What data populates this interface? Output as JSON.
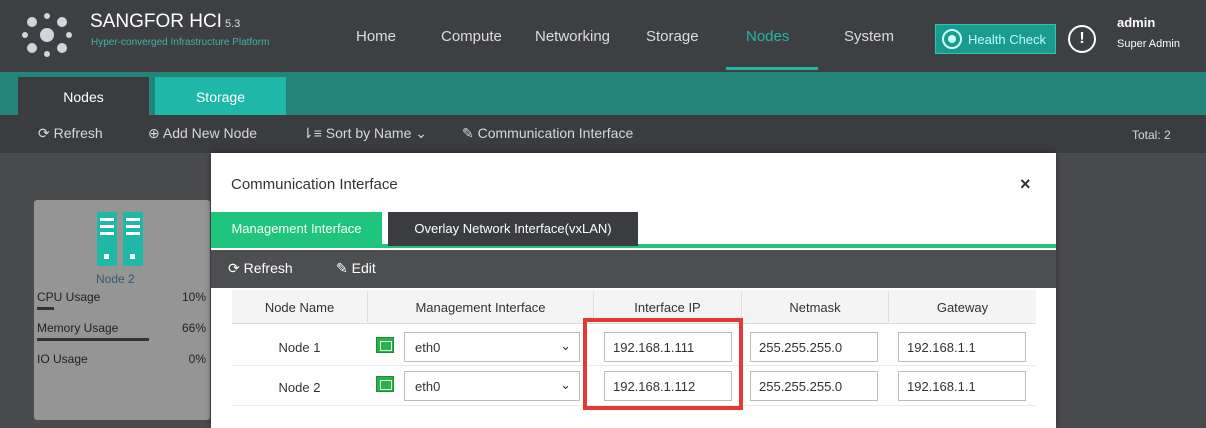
{
  "header": {
    "brand": "SANGFOR HCI",
    "version": "5.3",
    "subtitle": "Hyper-converged Infrastructure Platform",
    "nav": [
      "Home",
      "Compute",
      "Networking",
      "Storage",
      "Nodes",
      "System"
    ],
    "active_nav": "Nodes",
    "health_check": "Health Check",
    "user": "admin",
    "role": "Super Admin"
  },
  "subtabs": [
    "Nodes",
    "Storage"
  ],
  "toolbar": {
    "refresh": "Refresh",
    "add_node": "Add New Node",
    "sort": "Sort by Name",
    "comm_interface": "Communication Interface",
    "total": "Total: 2"
  },
  "node_card": {
    "name": "Node 2",
    "metrics": [
      {
        "label": "CPU Usage",
        "value": "10%",
        "level": 0.1
      },
      {
        "label": "Memory Usage",
        "value": "66%",
        "level": 0.66
      },
      {
        "label": "IO Usage",
        "value": "0%",
        "level": 0
      }
    ]
  },
  "modal": {
    "title": "Communication Interface",
    "close": "×",
    "tabs": [
      "Management Interface",
      "Overlay Network Interface(vxLAN)"
    ],
    "refresh": "Refresh",
    "edit": "Edit",
    "columns": [
      "Node Name",
      "Management Interface",
      "Interface IP",
      "Netmask",
      "Gateway"
    ],
    "rows": [
      {
        "node": "Node 1",
        "interface": "eth0",
        "ip": "192.168.1.111",
        "netmask": "255.255.255.0",
        "gateway": "192.168.1.1"
      },
      {
        "node": "Node 2",
        "interface": "eth0",
        "ip": "192.168.1.112",
        "netmask": "255.255.255.0",
        "gateway": "192.168.1.1"
      }
    ]
  },
  "colors": {
    "accent": "#1fb8a8",
    "tab_green": "#1fc47d",
    "highlight": "#e53935"
  }
}
